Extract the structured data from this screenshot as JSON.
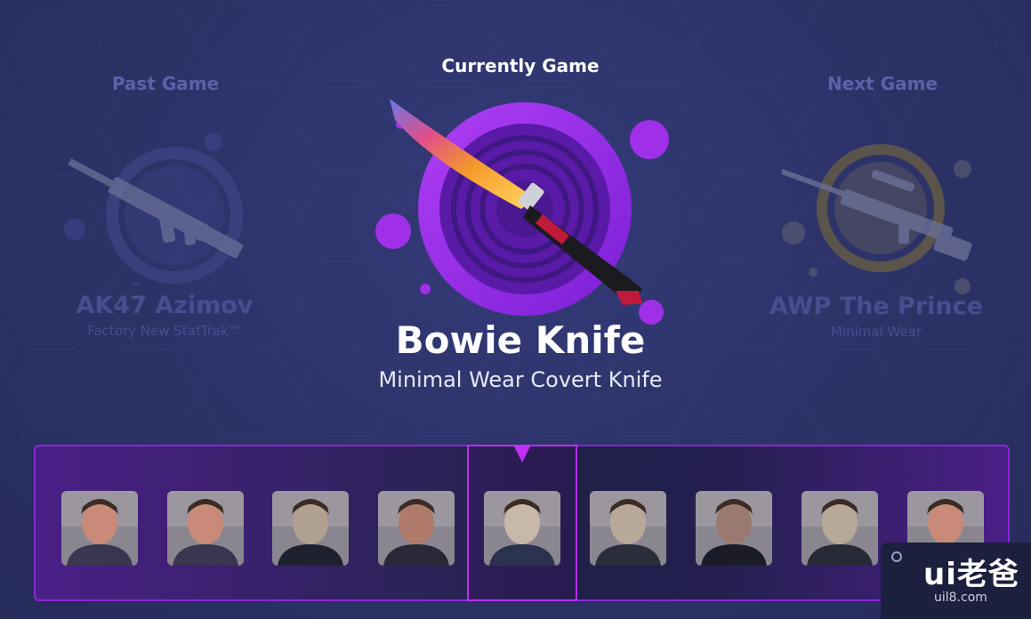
{
  "past": {
    "label": "Past Game",
    "title": "AK47 Azimov",
    "subtitle": "Factory New StatTrak™",
    "weapon_icon": "ak47-rifle"
  },
  "current": {
    "label": "Currently Game",
    "title": "Bowie Knife",
    "subtitle": "Minimal Wear Covert Knife",
    "weapon_icon": "bowie-knife"
  },
  "next": {
    "label": "Next Game",
    "title": "AWP The Prince",
    "subtitle": "Minimal Wear",
    "weapon_icon": "awp-sniper-rifle"
  },
  "players": [
    {
      "name": "player-1"
    },
    {
      "name": "player-2"
    },
    {
      "name": "player-3"
    },
    {
      "name": "player-4"
    },
    {
      "name": "player-5",
      "selected": true
    },
    {
      "name": "player-6"
    },
    {
      "name": "player-7"
    },
    {
      "name": "player-8"
    },
    {
      "name": "player-9"
    }
  ],
  "watermark": {
    "logo": "ui老爸",
    "url": "uil8.com"
  },
  "colors": {
    "background": "#2c3266",
    "accent_purple": "#9b2ee0",
    "gold_ring": "#b99a2a",
    "text_white": "#ffffff",
    "muted": "#474e8e"
  }
}
